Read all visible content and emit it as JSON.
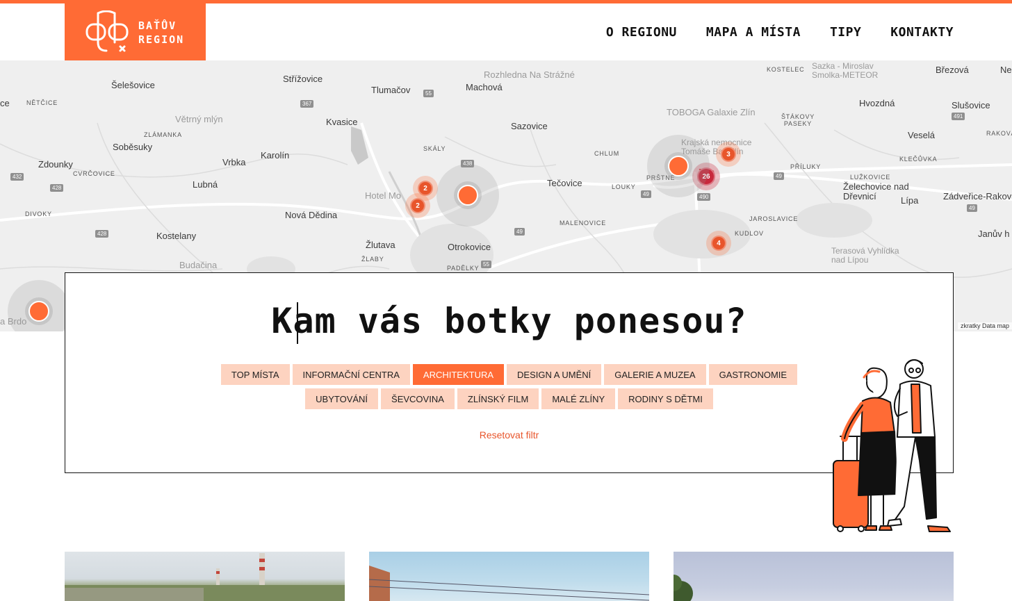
{
  "brand": {
    "line1": "BAŤŮV",
    "line2": "REGION",
    "accent": "#ff6b35"
  },
  "nav": [
    {
      "label": "O REGIONU"
    },
    {
      "label": "MAPA A MÍSTA"
    },
    {
      "label": "TIPY"
    },
    {
      "label": "KONTAKTY"
    }
  ],
  "map": {
    "places": [
      "Šelešovice",
      "Střížovice",
      "Tlumačov",
      "Machová",
      "Rozhledna Na Strážné",
      "KOSTELEC",
      "Sazka - Miroslav Smolka-METEOR",
      "Březová",
      "Ne",
      "ce",
      "NĚTČICE",
      "Větrný mlýn",
      "Kvasice",
      "Sazovice",
      "TOBOGA Galaxie Zlín",
      "ŠTÁKOVY PASEKY",
      "Hvozdná",
      "Slušovice",
      "ZLÁMANKA",
      "Soběsuky",
      "SKÁLY",
      "CHLUM",
      "Krajská nemocnice Tomáše Bati Zlín",
      "Veselá",
      "RAKOVÁ",
      "Zdounky",
      "CVRČOVICE",
      "Vrbka",
      "Karolín",
      "Lubná",
      "Tečovice",
      "LOUKY",
      "PRŠTNÉ",
      "Zlín",
      "PŘÍLUKY",
      "KLEČŮVKA",
      "Želechovice nad Dřevnicí",
      "LUŽKOVICE",
      "Lípa",
      "Zádveřice-Rakova",
      "DIVOKY",
      "Hotel Mo",
      "Nová Dědina",
      "MALENOVICE",
      "JAROSLAVICE",
      "Kostelany",
      "Žlutava",
      "Otrokovice",
      "KUDLOV",
      "Janův h",
      "ŽLABY",
      "PADĚLKY",
      "Budačina",
      "Terasová Vyhlídka nad Lípou",
      "a Brdo"
    ],
    "roads": [
      "367",
      "55",
      "438",
      "49",
      "428",
      "432",
      "428",
      "55",
      "49",
      "49",
      "490",
      "49",
      "491"
    ],
    "clusters": [
      {
        "count": "2"
      },
      {
        "count": "2"
      },
      {
        "count": "3"
      },
      {
        "count": "26"
      },
      {
        "count": "4"
      }
    ],
    "attribution": "zkratky   Data map"
  },
  "filter": {
    "headline": "Kam vás botky ponesou?",
    "categories": [
      {
        "label": "TOP MÍSTA",
        "active": false
      },
      {
        "label": "INFORMAČNÍ CENTRA",
        "active": false
      },
      {
        "label": "ARCHITEKTURA",
        "active": true
      },
      {
        "label": "DESIGN A UMĚNÍ",
        "active": false
      },
      {
        "label": "GALERIE A MUZEA",
        "active": false
      },
      {
        "label": "GASTRONOMIE",
        "active": false
      },
      {
        "label": "UBYTOVÁNÍ",
        "active": false
      },
      {
        "label": "ŠEVCOVINA",
        "active": false
      },
      {
        "label": "ZLÍNSKÝ FILM",
        "active": false
      },
      {
        "label": "MALÉ ZLÍNY",
        "active": false
      },
      {
        "label": "RODINY S DĚTMI",
        "active": false
      }
    ],
    "reset_label": "Resetovat filtr"
  }
}
